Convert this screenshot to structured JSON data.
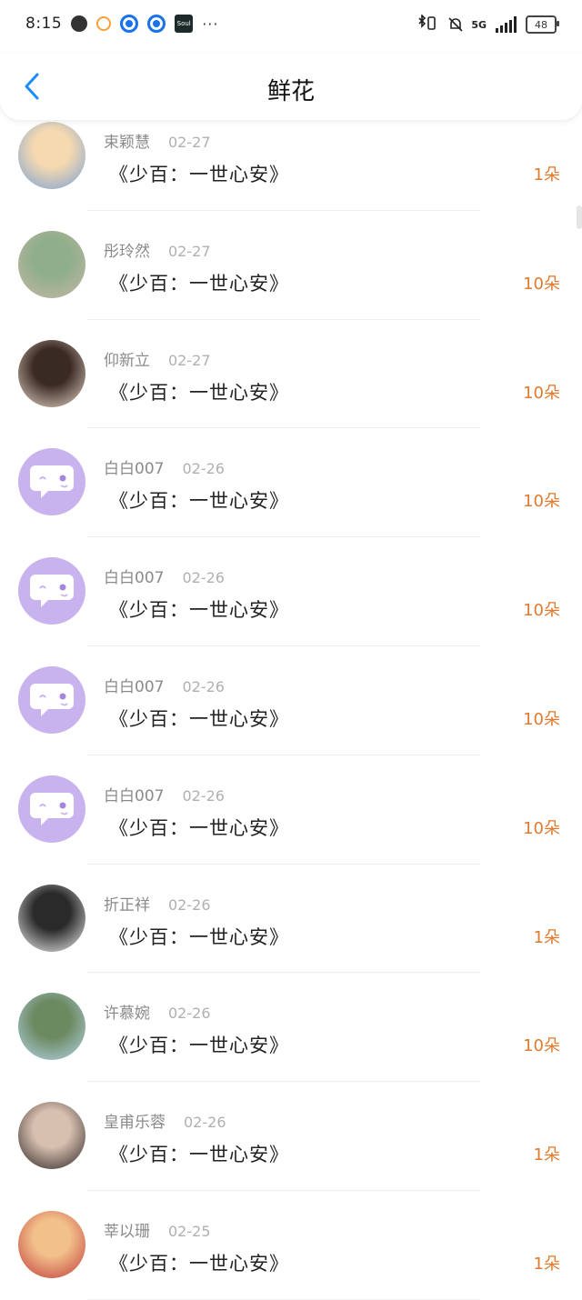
{
  "status_bar": {
    "time": "8:15",
    "soul_label": "Soul",
    "more": "···",
    "network": "5G",
    "battery": "48"
  },
  "header": {
    "title": "鲜花"
  },
  "colors": {
    "accent": "#1a8cff",
    "count": "#e07a2e",
    "avatar_default": "#c9b3ee"
  },
  "items": [
    {
      "name": "束颖慧",
      "date": "02-27",
      "book": "《少百：一世心安》",
      "count": "1朵",
      "avatar": "anime-girl",
      "avatar_colors": [
        "#f5d9b0",
        "#7aa0d6"
      ]
    },
    {
      "name": "彤玲然",
      "date": "02-27",
      "book": "《少百：一世心安》",
      "count": "10朵",
      "avatar": "street-photo",
      "avatar_colors": [
        "#8fae8a",
        "#c7b8a8"
      ]
    },
    {
      "name": "仰新立",
      "date": "02-27",
      "book": "《少百：一世心安》",
      "count": "10朵",
      "avatar": "anime-dark",
      "avatar_colors": [
        "#3a2a24",
        "#e8d8c8"
      ]
    },
    {
      "name": "白白007",
      "date": "02-26",
      "book": "《少百：一世心安》",
      "count": "10朵",
      "avatar": "default-chat",
      "avatar_colors": [
        "#c9b3ee",
        "#ffffff"
      ]
    },
    {
      "name": "白白007",
      "date": "02-26",
      "book": "《少百：一世心安》",
      "count": "10朵",
      "avatar": "default-chat",
      "avatar_colors": [
        "#c9b3ee",
        "#ffffff"
      ]
    },
    {
      "name": "白白007",
      "date": "02-26",
      "book": "《少百：一世心安》",
      "count": "10朵",
      "avatar": "default-chat",
      "avatar_colors": [
        "#c9b3ee",
        "#ffffff"
      ]
    },
    {
      "name": "白白007",
      "date": "02-26",
      "book": "《少百：一世心安》",
      "count": "10朵",
      "avatar": "default-chat",
      "avatar_colors": [
        "#c9b3ee",
        "#ffffff"
      ]
    },
    {
      "name": "折正祥",
      "date": "02-26",
      "book": "《少百：一世心安》",
      "count": "1朵",
      "avatar": "text-sky",
      "avatar_colors": [
        "#2a2a2a",
        "#f2f2f2"
      ]
    },
    {
      "name": "许慕婉",
      "date": "02-26",
      "book": "《少百：一世心安》",
      "count": "10朵",
      "avatar": "hanfu-girl",
      "avatar_colors": [
        "#6b8a60",
        "#b8d4ea"
      ]
    },
    {
      "name": "皇甫乐蓉",
      "date": "02-26",
      "book": "《少百：一世心安》",
      "count": "1朵",
      "avatar": "two-girls",
      "avatar_colors": [
        "#d8c0b0",
        "#2a2222"
      ]
    },
    {
      "name": "莘以珊",
      "date": "02-25",
      "book": "《少百：一世心安》",
      "count": "1朵",
      "avatar": "boy-portrait",
      "avatar_colors": [
        "#f2c08a",
        "#c0393b"
      ]
    }
  ]
}
